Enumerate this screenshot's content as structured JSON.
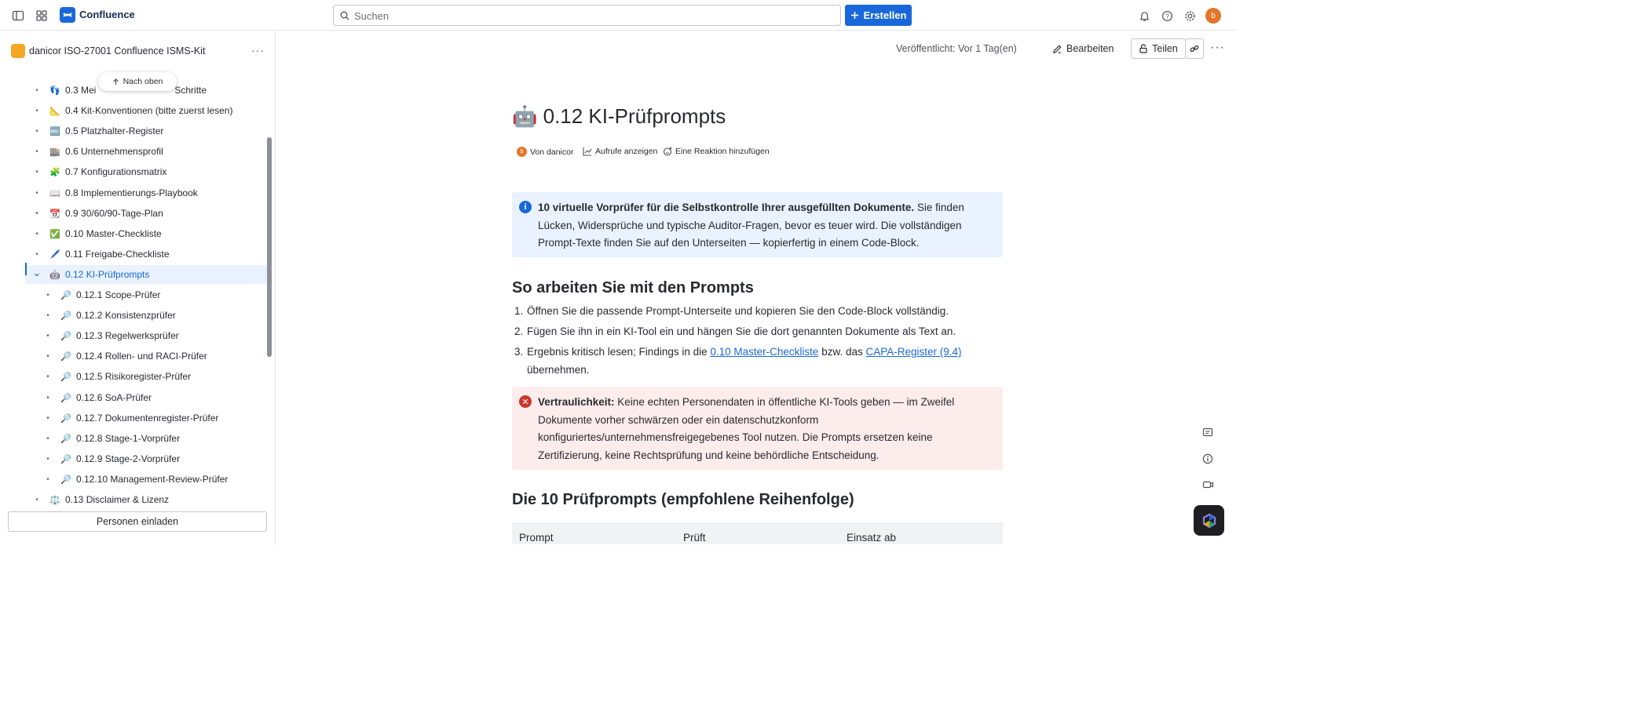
{
  "topbar": {
    "app_name": "Confluence",
    "search_placeholder": "Suchen",
    "create_label": "Erstellen",
    "avatar_initial": "b"
  },
  "sidebar": {
    "space_name": "danicor ISO-27001 Confluence ISMS-Kit",
    "back_to_top": "Nach oben",
    "invite_label": "Personen einladen",
    "items": [
      {
        "emoji": "👣",
        "label": "0.3 Meilensteine & nächste Schritte",
        "visible_label_start": "0.3 Mei",
        "visible_label_end": "Schritte"
      },
      {
        "emoji": "📐",
        "label": "0.4 Kit-Konventionen (bitte zuerst lesen)"
      },
      {
        "emoji": "🔤",
        "label": "0.5 Platzhalter-Register"
      },
      {
        "emoji": "🏬",
        "label": "0.6 Unternehmensprofil"
      },
      {
        "emoji": "🧩",
        "label": "0.7 Konfigurationsmatrix"
      },
      {
        "emoji": "📖",
        "label": "0.8 Implementierungs-Playbook"
      },
      {
        "emoji": "📆",
        "label": "0.9 30/60/90-Tage-Plan"
      },
      {
        "emoji": "✅",
        "label": "0.10 Master-Checkliste"
      },
      {
        "emoji": "🖊️",
        "label": "0.11 Freigabe-Checkliste"
      },
      {
        "emoji": "🤖",
        "label": "0.12 KI-Prüfprompts"
      },
      {
        "emoji": "🔎",
        "label": "0.12.1 Scope-Prüfer"
      },
      {
        "emoji": "🔎",
        "label": "0.12.2 Konsistenzprüfer"
      },
      {
        "emoji": "🔎",
        "label": "0.12.3 Regelwerksprüfer"
      },
      {
        "emoji": "🔎",
        "label": "0.12.4 Rollen- und RACI-Prüfer"
      },
      {
        "emoji": "🔎",
        "label": "0.12.5 Risikoregister-Prüfer"
      },
      {
        "emoji": "🔎",
        "label": "0.12.6 SoA-Prüfer"
      },
      {
        "emoji": "🔎",
        "label": "0.12.7 Dokumentenregister-Prüfer"
      },
      {
        "emoji": "🔎",
        "label": "0.12.8 Stage-1-Vorprüfer"
      },
      {
        "emoji": "🔎",
        "label": "0.12.9 Stage-2-Vorprüfer"
      },
      {
        "emoji": "🔎",
        "label": "0.12.10 Management-Review-Prüfer"
      },
      {
        "emoji": "⚖️",
        "label": "0.13 Disclaimer & Lizenz"
      }
    ]
  },
  "page_header": {
    "published": "Veröffentlicht: Vor 1 Tag(en)",
    "edit_label": "Bearbeiten",
    "share_label": "Teilen"
  },
  "content": {
    "title_emoji": "🤖",
    "title": "0.12 KI-Prüfprompts",
    "meta_author": "Von danicor",
    "meta_views": "Aufrufe anzeigen",
    "meta_reaction": "Eine Reaktion hinzufügen",
    "info_bold": "10 virtuelle Vorprüfer für die Selbstkontrolle Ihrer ausgefüllten Dokumente.",
    "info_text": " Sie finden Lücken, Widersprüche und typische Auditor-Fragen, bevor es teuer wird. Die vollständigen Prompt-Texte finden Sie auf den Unterseiten — kopierfertig in einem Code-Block.",
    "h2_work": "So arbeiten Sie mit den Prompts",
    "steps": {
      "s1": "Öffnen Sie die passende Prompt-Unterseite und kopieren Sie den Code-Block vollständig.",
      "s2": "Fügen Sie ihn in ein KI-Tool ein und hängen Sie die dort genannten Dokumente als Text an.",
      "s3_a": "Ergebnis kritisch lesen; Findings in die ",
      "s3_link1": "0.10 Master-Checkliste",
      "s3_b": " bzw. das ",
      "s3_link2": "CAPA-Register (9.4)",
      "s3_c": "übernehmen."
    },
    "error_bold": "Vertraulichkeit:",
    "error_text": " Keine echten Personendaten in öffentliche KI-Tools geben — im Zweifel Dokumente vorher schwärzen oder ein datenschutzkonform konfiguriertes/unternehmensfreigegebenes Tool nutzen. Die Prompts ersetzen keine Zertifizierung, keine Rechtsprüfung und keine behördliche Entscheidung.",
    "h2_list": "Die 10 Prüfprompts (empfohlene Reihenfolge)",
    "table_headers": [
      "Prompt",
      "Prüft",
      "Einsatz ab"
    ]
  },
  "colors": {
    "accent": "#1868db",
    "info_bg": "#e9f2fe",
    "error_bg": "#fdecec",
    "error_icon": "#c9372c"
  }
}
